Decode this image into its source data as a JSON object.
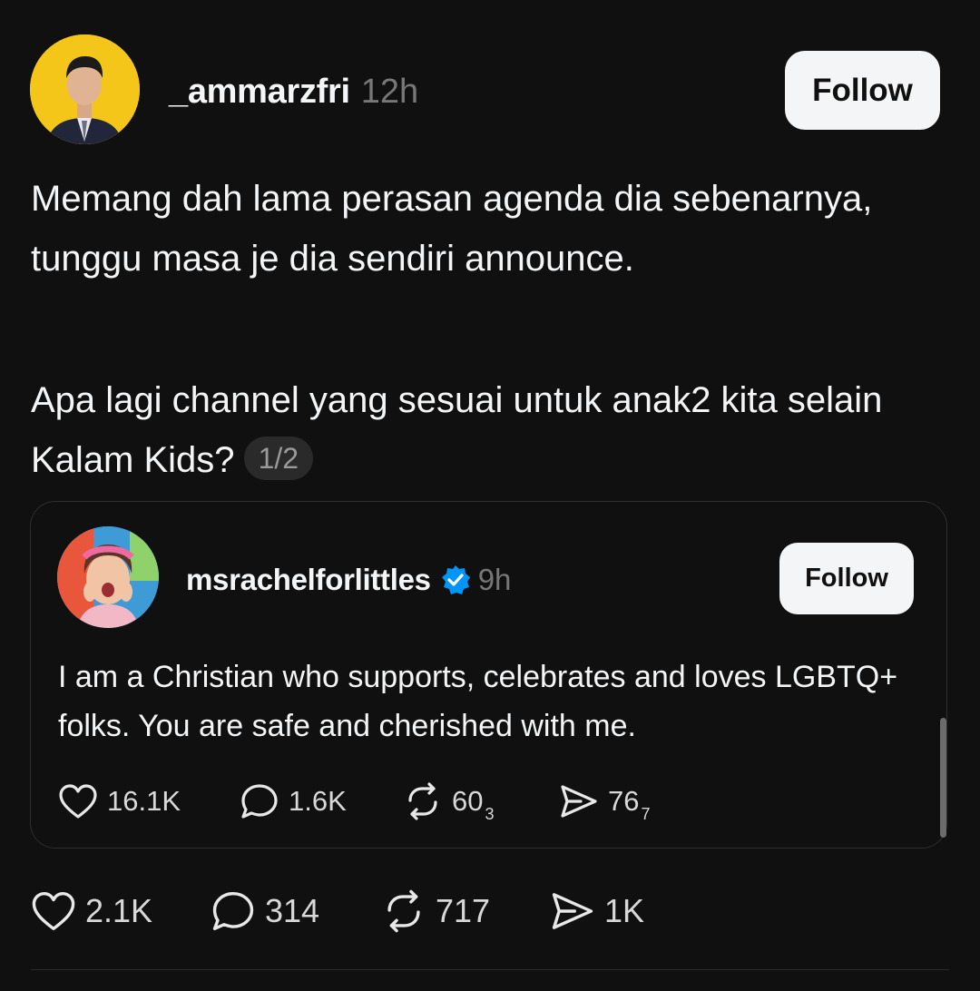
{
  "post": {
    "author": "_ammarzfri",
    "time": "12h",
    "follow_label": "Follow",
    "paragraph_1": "Memang dah lama perasan agenda dia sebenarnya, tunggu masa je dia sendiri announce.",
    "paragraph_2": "Apa lagi channel yang sesuai untuk anak2 kita selain Kalam Kids?",
    "thread_index": "1/2",
    "actions": {
      "likes": "2.1K",
      "replies": "314",
      "reposts": "717",
      "shares": "1K"
    }
  },
  "quoted_post": {
    "author": "msrachelforlittles",
    "verified": true,
    "time": "9h",
    "follow_label": "Follow",
    "text": "I am a Christian who supports, celebrates and loves LGBTQ+ folks. You are safe and cherished with me.",
    "actions": {
      "likes": "16.1K",
      "replies": "1.6K",
      "reposts": "60",
      "reposts_suffix": "3",
      "shares": "76",
      "shares_suffix": "7"
    }
  },
  "colors": {
    "background": "#101010",
    "text": "#f3f5f7",
    "muted": "#777777",
    "verified_blue": "#0095f6",
    "avatar_bg": "#f4c61a"
  }
}
